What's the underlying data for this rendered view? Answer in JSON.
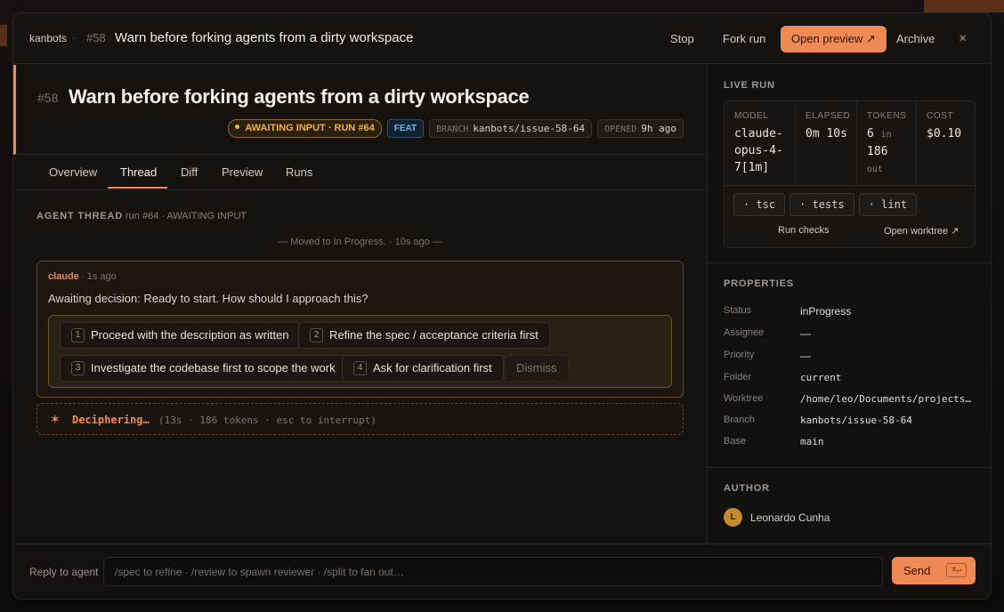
{
  "header": {
    "brand": "kanbots",
    "separator": "·",
    "number": "#58",
    "title": "Warn before forking agents from a dirty workspace",
    "stop": "Stop",
    "fork": "Fork run",
    "open_preview": "Open preview ↗",
    "archive": "Archive",
    "close": "×"
  },
  "issue": {
    "number": "#58",
    "title": "Warn before forking agents from a dirty workspace",
    "status_chip": "AWAITING INPUT · RUN #64",
    "type_chip": "FEAT",
    "branch_key": "BRANCH",
    "branch_value": "kanbots/issue-58-64",
    "opened_key": "OPENED",
    "opened_value": "9h ago"
  },
  "tabs": [
    "Overview",
    "Thread",
    "Diff",
    "Preview",
    "Runs"
  ],
  "thread": {
    "label": "AGENT THREAD",
    "sub": "run #64 · AWAITING INPUT",
    "system_line": "— Moved to In Progress. · 10s ago —",
    "message": {
      "author": "claude",
      "time": "· 1s ago",
      "text": "Awaiting decision: Ready to start. How should I approach this?"
    },
    "options": [
      {
        "n": "1",
        "label": "Proceed with the description as written"
      },
      {
        "n": "2",
        "label": "Refine the spec / acceptance criteria first"
      },
      {
        "n": "3",
        "label": "Investigate the codebase first to scope the work"
      },
      {
        "n": "4",
        "label": "Ask for clarification first"
      }
    ],
    "dismiss": "Dismiss",
    "status": {
      "star": "✶",
      "main": "Deciphering…",
      "meta": "(13s · 186 tokens · esc to interrupt)"
    }
  },
  "live_run": {
    "label": "LIVE RUN",
    "model_label": "MODEL",
    "model": "claude-opus-4-7[1m]",
    "elapsed_label": "ELAPSED",
    "elapsed": "0m 10s",
    "tokens_label": "TOKENS",
    "tokens_in": "6",
    "tokens_in_unit": "in",
    "tokens_out": "186",
    "tokens_out_unit": "out",
    "cost_label": "COST",
    "cost": "$0.10",
    "checks": [
      "· tsc",
      "· tests",
      "· lint"
    ],
    "run_checks": "Run checks",
    "open_worktree": "Open worktree ↗"
  },
  "properties": {
    "label": "PROPERTIES",
    "rows": [
      {
        "k": "Status",
        "v": "inProgress"
      },
      {
        "k": "Assignee",
        "v": "—"
      },
      {
        "k": "Priority",
        "v": "—"
      },
      {
        "k": "Folder",
        "v": "current"
      },
      {
        "k": "Worktree",
        "v": "/home/leo/Documents/projects/kanbots"
      },
      {
        "k": "Branch",
        "v": "kanbots/issue-58-64"
      },
      {
        "k": "Base",
        "v": "main"
      }
    ]
  },
  "author": {
    "label": "AUTHOR",
    "initial": "L",
    "name": "Leonardo Cunha"
  },
  "footer": {
    "label": "Reply to agent",
    "placeholder": "/spec to refine · /review to spawn reviewer · /split to fan out…",
    "send": "Send",
    "shortcut": "⌘↵"
  },
  "colors": {
    "accent": "#f08a55",
    "awaiting": "#f0b24a",
    "feat": "#73b4e3",
    "background": "#151210"
  }
}
